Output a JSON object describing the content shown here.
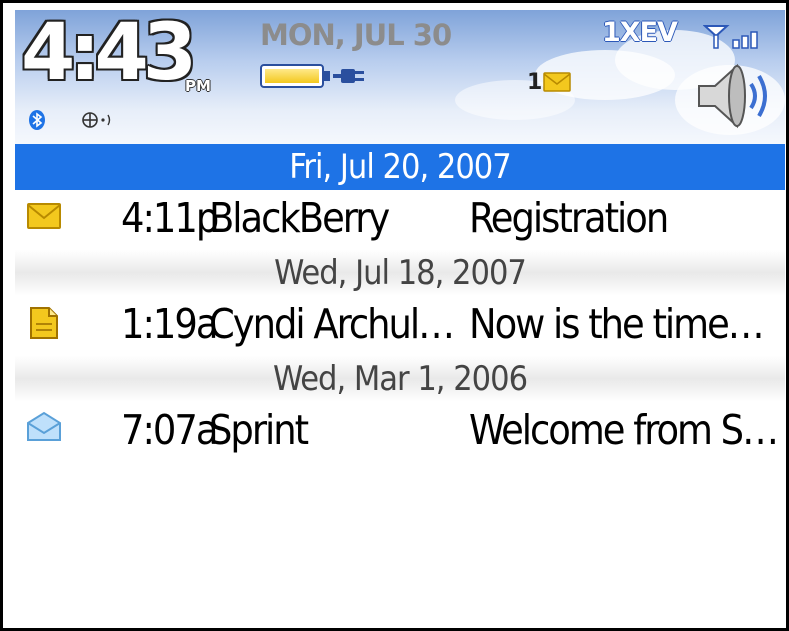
{
  "status_bar": {
    "time": "4:43",
    "ampm": "PM",
    "date": "MON, JUL 30",
    "network": "1XEV",
    "unread_count": "1",
    "icons": {
      "battery": "battery-charging-icon",
      "signal": "signal-bars-icon",
      "mail": "envelope-icon",
      "sound": "speaker-icon",
      "bluetooth": "bluetooth-icon",
      "radio": "radio-antenna-icon"
    }
  },
  "messages": {
    "groups": [
      {
        "date": "Fri, Jul 20, 2007",
        "selected": true,
        "items": [
          {
            "icon": "envelope-icon",
            "time": "4:11p",
            "sender": "BlackBerry",
            "subject": "Registration"
          }
        ]
      },
      {
        "date": "Wed, Jul 18, 2007",
        "selected": false,
        "items": [
          {
            "icon": "document-icon",
            "time": "1:19a",
            "sender": "Cyndi Archul…",
            "subject": "Now is the time…"
          }
        ]
      },
      {
        "date": "Wed, Mar 1, 2006",
        "selected": false,
        "items": [
          {
            "icon": "opened-envelope-icon",
            "time": "7:07a",
            "sender": "Sprint",
            "subject": "Welcome from S…"
          }
        ]
      }
    ]
  },
  "colors": {
    "selection": "#1e73e6",
    "header_sky": "#7fa3d9",
    "envelope_yellow": "#f3c81e"
  }
}
